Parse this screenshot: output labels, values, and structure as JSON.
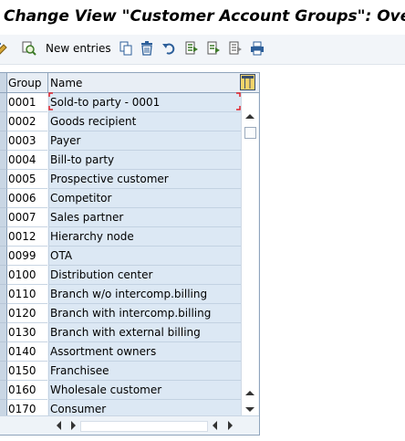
{
  "window": {
    "title": "Change View \"Customer Account Groups\": Overview"
  },
  "toolbar": {
    "new_entries_label": "New entries",
    "icons": [
      "display-change-icon",
      "where-used-icon",
      "copy-icon",
      "delete-icon",
      "undo-icon",
      "select-all-icon",
      "select-block-icon",
      "deselect-all-icon",
      "print-icon"
    ]
  },
  "table": {
    "columns": [
      "Group",
      "Name"
    ],
    "rows": [
      {
        "group": "0001",
        "name": "Sold-to party - 0001"
      },
      {
        "group": "0002",
        "name": "Goods recipient"
      },
      {
        "group": "0003",
        "name": "Payer"
      },
      {
        "group": "0004",
        "name": "Bill-to party"
      },
      {
        "group": "0005",
        "name": "Prospective customer"
      },
      {
        "group": "0006",
        "name": "Competitor"
      },
      {
        "group": "0007",
        "name": "Sales partner"
      },
      {
        "group": "0012",
        "name": "Hierarchy node"
      },
      {
        "group": "0099",
        "name": "OTA"
      },
      {
        "group": "0100",
        "name": "Distribution center"
      },
      {
        "group": "0110",
        "name": "Branch w/o intercomp.billing"
      },
      {
        "group": "0120",
        "name": "Branch with intercomp.billing"
      },
      {
        "group": "0130",
        "name": "Branch with external billing"
      },
      {
        "group": "0140",
        "name": "Assortment owners"
      },
      {
        "group": "0150",
        "name": "Franchisee"
      },
      {
        "group": "0160",
        "name": "Wholesale customer"
      },
      {
        "group": "0170",
        "name": "Consumer"
      }
    ]
  },
  "colors": {
    "row_bg": "#dce8f4",
    "header_bg": "#e8eef5",
    "focus_marker": "#e0202a",
    "toolbar_bg": "#f2f5f9"
  }
}
